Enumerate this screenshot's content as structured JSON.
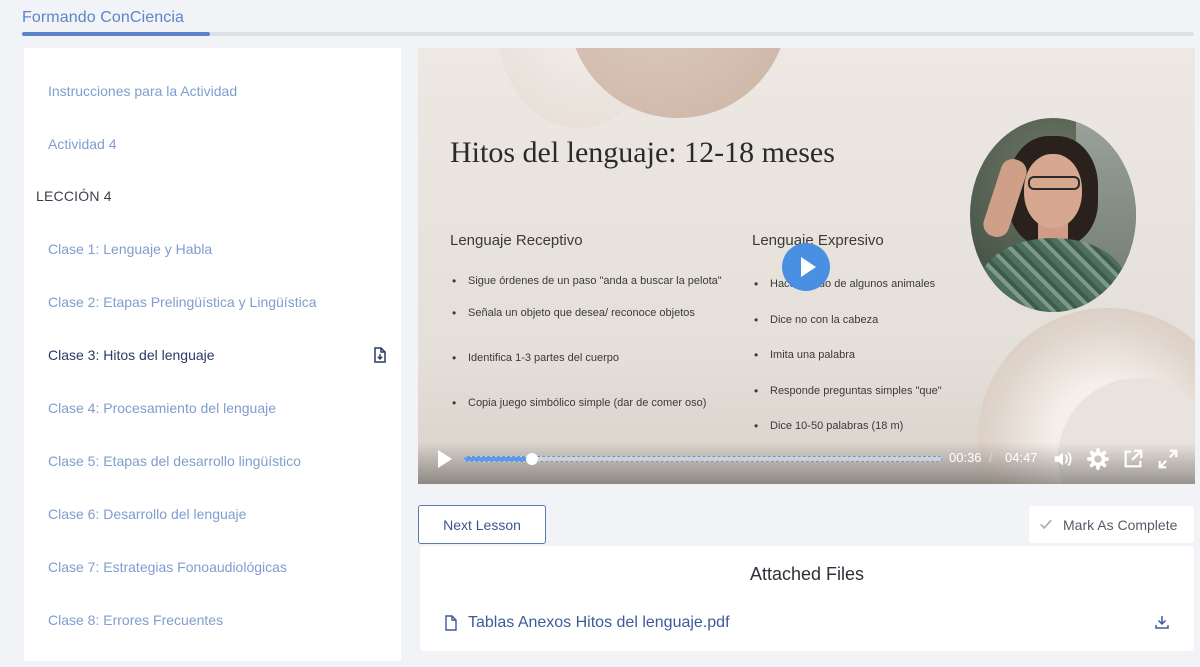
{
  "header": {
    "brand": "Formando ConCiencia",
    "progress_fraction": 0.16
  },
  "sidebar": {
    "items": [
      {
        "label": "Instrucciones para la Actividad",
        "kind": "lesson"
      },
      {
        "label": "Actividad 4",
        "kind": "lesson"
      },
      {
        "label": "LECCIÓN 4",
        "kind": "section"
      },
      {
        "label": "Clase 1: Lenguaje y Habla",
        "kind": "lesson"
      },
      {
        "label": "Clase 2: Etapas Prelingüística y Lingüística",
        "kind": "lesson"
      },
      {
        "label": "Clase 3: Hitos del lenguaje",
        "kind": "active"
      },
      {
        "label": "Clase 4: Procesamiento del lenguaje",
        "kind": "lesson"
      },
      {
        "label": "Clase 5: Etapas del desarrollo lingüístico",
        "kind": "lesson"
      },
      {
        "label": "Clase 6: Desarrollo del lenguaje",
        "kind": "lesson"
      },
      {
        "label": "Clase 7: Estrategias Fonoaudiológicas",
        "kind": "lesson"
      },
      {
        "label": "Clase 8: Errores Frecuentes",
        "kind": "lesson"
      }
    ]
  },
  "video": {
    "slide_title": "Hitos del lenguaje: 12-18 meses",
    "receptive": {
      "heading": "Lenguaje Receptivo",
      "bullets": [
        "Sigue órdenes de un paso \"anda a buscar la pelota\"",
        "Señala un objeto que desea/ reconoce objetos",
        "Identifica 1-3 partes del cuerpo",
        "Copia juego simbólico simple (dar de comer oso)"
      ]
    },
    "expressive": {
      "heading": "Lenguaje Expresivo",
      "bullets": [
        "Hace sonido de algunos animales",
        "Dice no con la cabeza",
        "Imita una palabra",
        "Responde preguntas simples \"que\"",
        "Dice 10-50 palabras (18 m)"
      ]
    },
    "current_time": "00:36",
    "time_separator": "/",
    "duration": "04:47",
    "played_fraction": 0.14,
    "accent_color": "#4a90e2"
  },
  "actions": {
    "next_label": "Next Lesson",
    "complete_label": "Mark As Complete"
  },
  "files": {
    "title": "Attached Files",
    "items": [
      {
        "name": "Tablas Anexos Hitos del lenguaje.pdf"
      }
    ]
  }
}
